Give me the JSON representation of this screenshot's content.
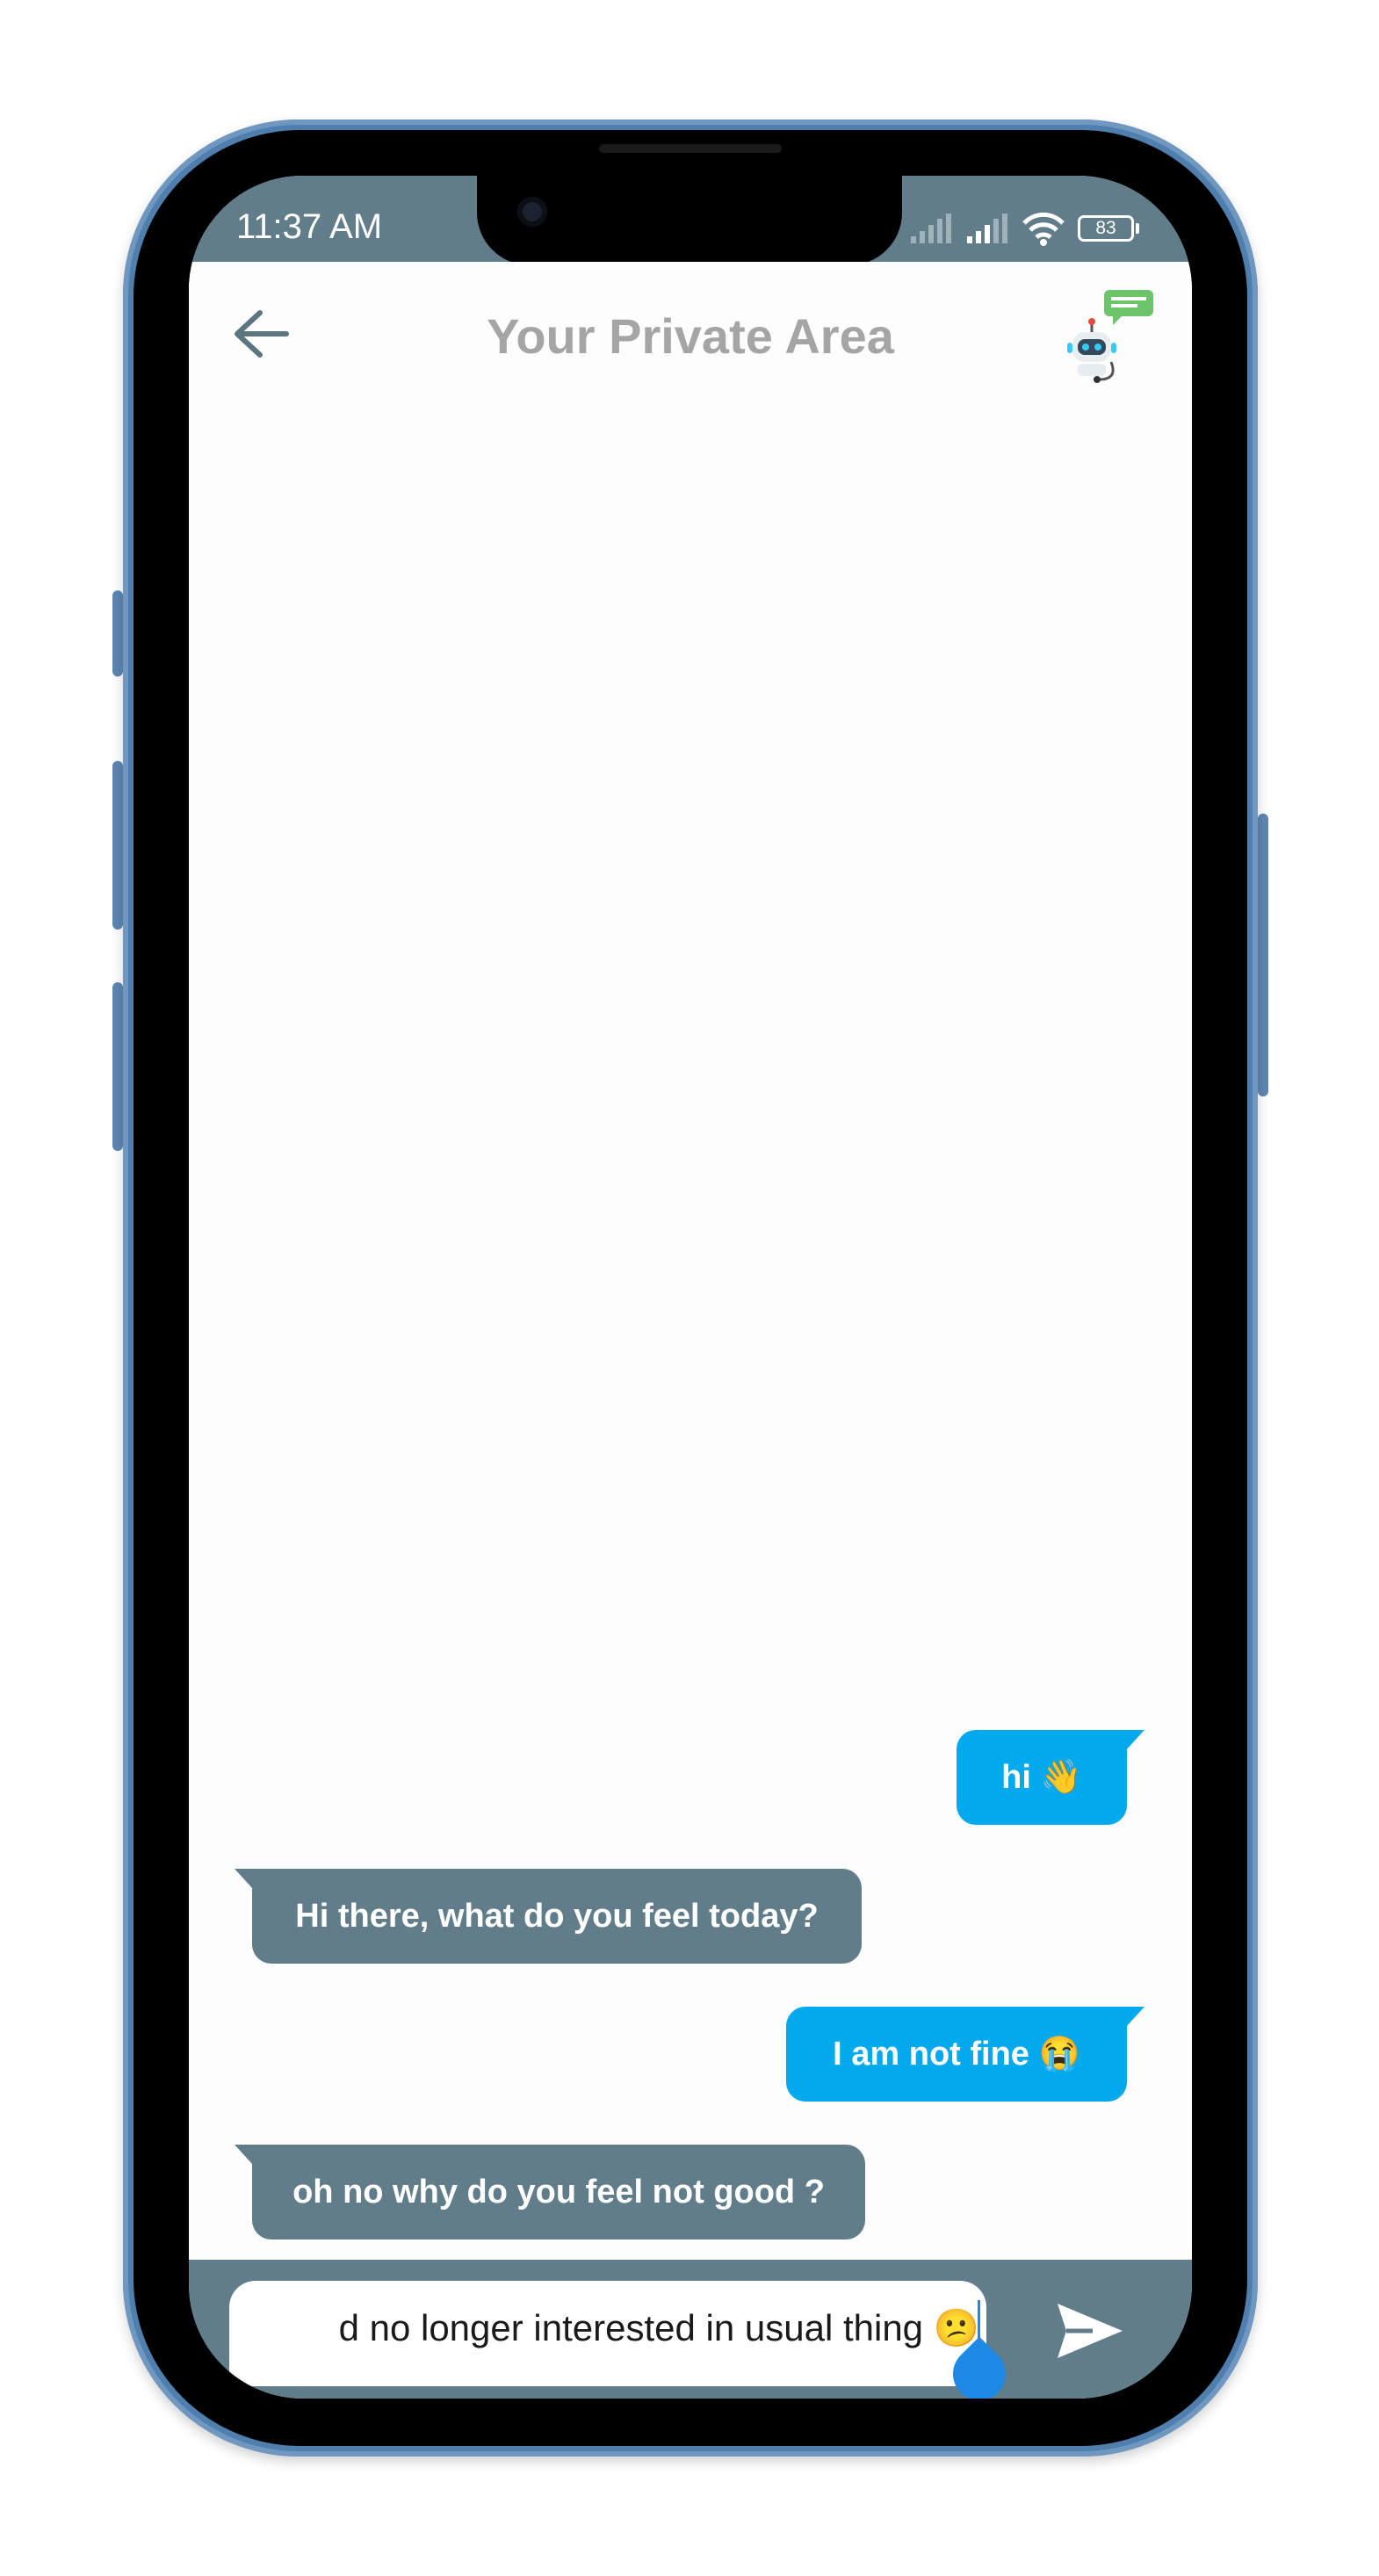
{
  "status_bar": {
    "time": "11:37 AM",
    "battery": "83",
    "icons": [
      "signal-icon",
      "signal-icon",
      "wifi-icon",
      "battery-icon"
    ]
  },
  "app_bar": {
    "title": "Your Private Area",
    "back_icon": "arrow-left-icon",
    "bot_icon": "chatbot-icon"
  },
  "messages": [
    {
      "sender": "user",
      "text": "hi 👋"
    },
    {
      "sender": "bot",
      "text": "Hi there, what do you feel today?"
    },
    {
      "sender": "user",
      "text": "I am not fine 😭"
    },
    {
      "sender": "bot",
      "text": "oh no why do you feel not good ?"
    }
  ],
  "composer": {
    "value": "d no longer interested in usual thing 😕",
    "send_icon": "send-icon"
  },
  "colors": {
    "header": "#617d89",
    "user_bubble": "#02a9ec",
    "bot_bubble": "#617d89",
    "title": "#a5a5a5",
    "frame": "#4f7fae"
  }
}
